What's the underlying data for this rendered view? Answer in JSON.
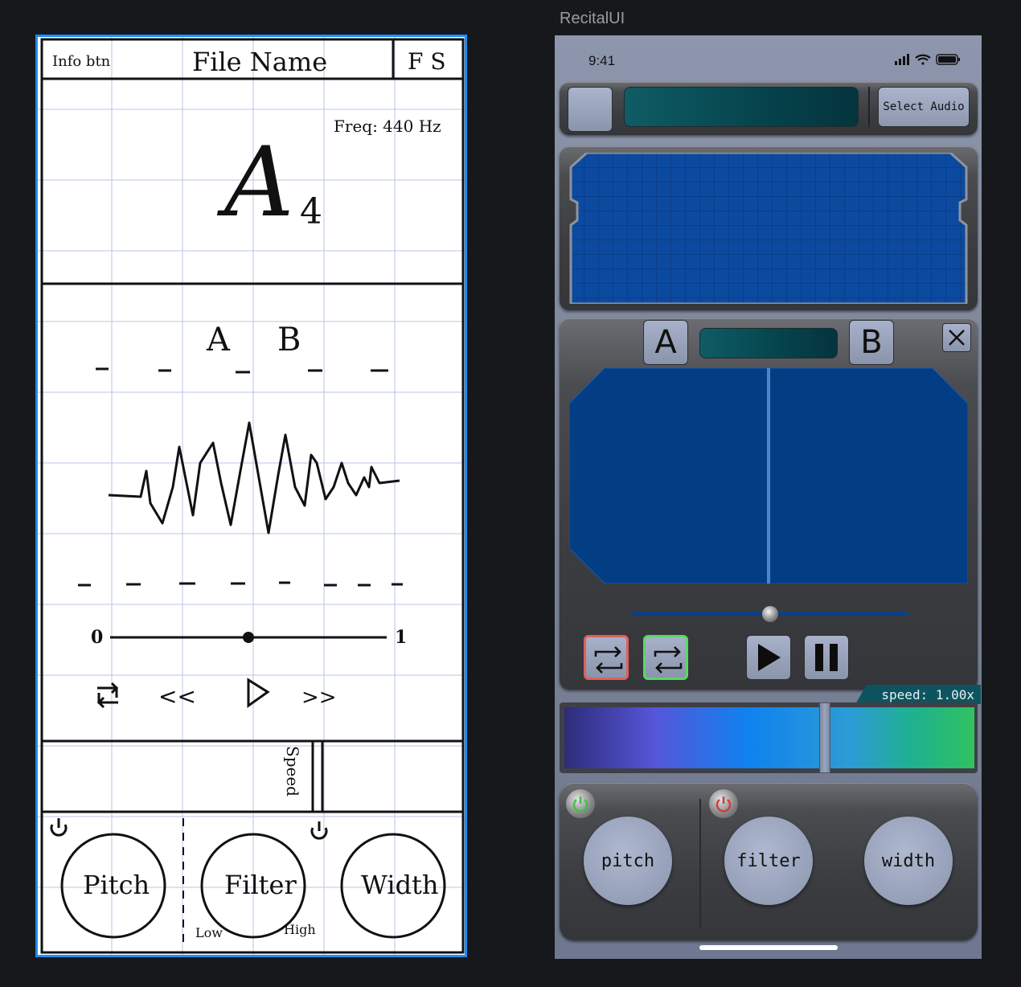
{
  "sketch": {
    "header": {
      "info_label": "Info btn",
      "title": "File Name",
      "fs_label": "F S"
    },
    "tuner": {
      "freq_label": "Freq: 440 Hz",
      "note": "A",
      "octave": "4"
    },
    "ab": {
      "a_label": "A",
      "b_label": "B"
    },
    "progress": {
      "min_label": "0",
      "max_label": "1",
      "value": 0.5
    },
    "transport": {
      "loop_icon": "loop-icon",
      "rewind_label": "<<",
      "forward_label": ">>"
    },
    "speed": {
      "label": "Speed"
    },
    "effects": {
      "pitch": "Pitch",
      "filter": "Filter",
      "width": "Width",
      "low": "Low",
      "high": "High"
    }
  },
  "phone": {
    "frame_title": "RecitalUI",
    "status": {
      "time": "9:41"
    },
    "top_bar": {
      "select_audio": "Select Audio"
    },
    "ab_loop": {
      "a_label": "A",
      "b_label": "B",
      "close_icon": "close-icon"
    },
    "playback": {
      "progress": 0.5,
      "loop_off_color": "#e0605a",
      "loop_on_color": "#58d866",
      "play_icon": "play-icon",
      "pause_icon": "pause-icon"
    },
    "speed": {
      "label": "speed: 1.00x",
      "position": 0.635
    },
    "effects": {
      "pitch_label": "pitch",
      "filter_label": "filter",
      "width_label": "width",
      "pitch_power_color": "#3cc24a",
      "filter_power_color": "#d23a3a"
    }
  }
}
